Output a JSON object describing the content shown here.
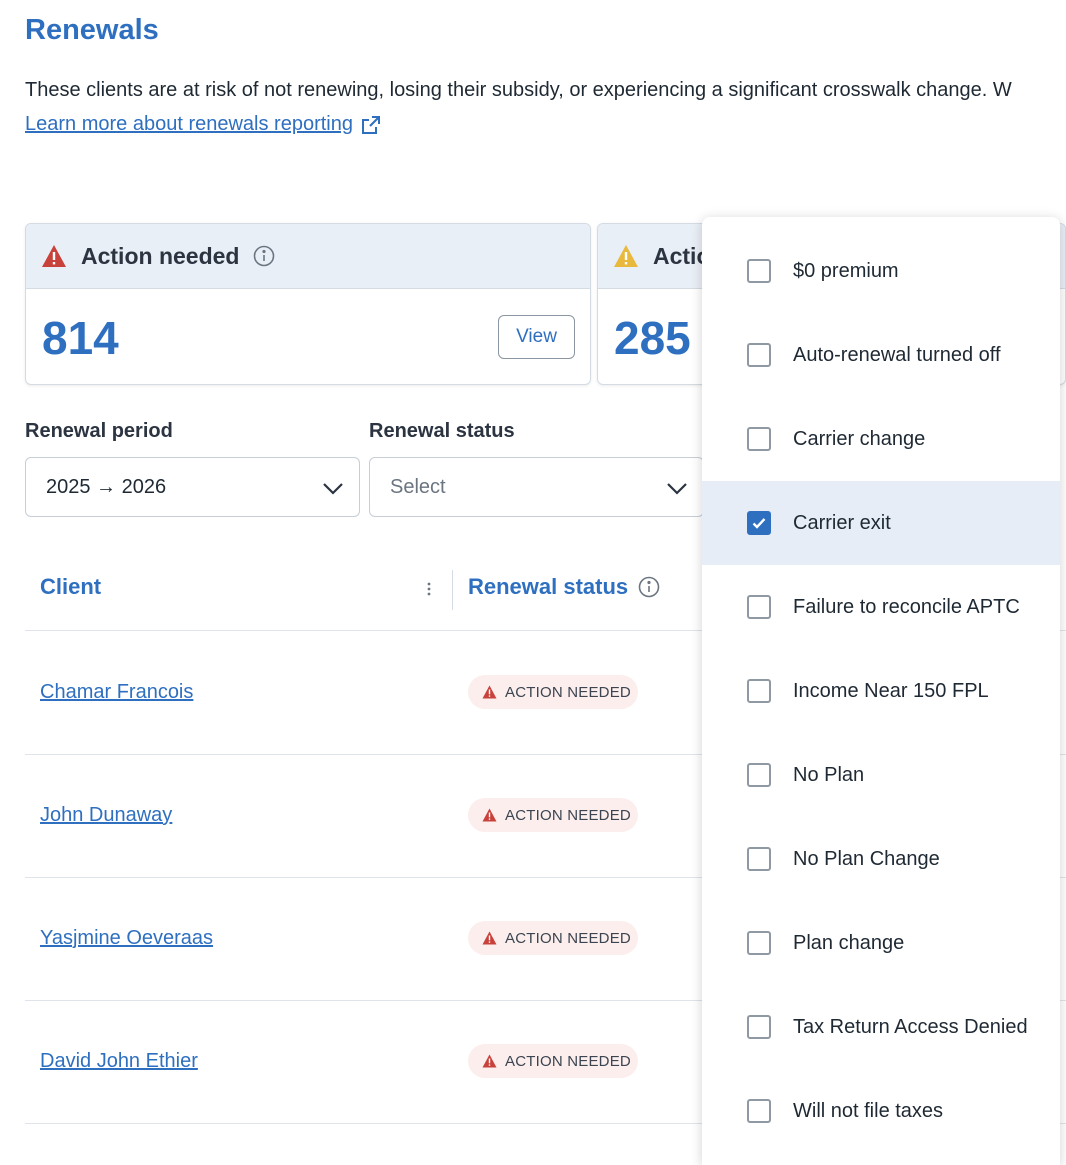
{
  "page": {
    "title": "Renewals",
    "intro": "These clients are at risk of not renewing, losing their subsidy, or experiencing a significant crosswalk change. W",
    "learn_more": "Learn more about renewals reporting"
  },
  "cards": [
    {
      "title": "Action needed",
      "count": "814",
      "view_label": "View",
      "icon": "warning-red-icon",
      "color": "#c8413b"
    },
    {
      "title": "Actio",
      "count": "285",
      "icon": "warning-yellow-icon",
      "color": "#e8b93c"
    }
  ],
  "filters": {
    "renewal_period": {
      "label": "Renewal period",
      "value": "2025 → 2026"
    },
    "renewal_status": {
      "label": "Renewal status",
      "placeholder": "Select"
    }
  },
  "table": {
    "headers": {
      "client": "Client",
      "renewal_status": "Renewal status"
    },
    "rows": [
      {
        "client": "Chamar Francois",
        "status": "ACTION NEEDED"
      },
      {
        "client": "John Dunaway",
        "status": "ACTION NEEDED"
      },
      {
        "client": "Yasjmine Oeveraas",
        "status": "ACTION NEEDED"
      },
      {
        "client": "David John Ethier",
        "status": "ACTION NEEDED"
      }
    ]
  },
  "dropdown": {
    "options": [
      {
        "label": "$0 premium",
        "checked": false
      },
      {
        "label": "Auto-renewal turned off",
        "checked": false
      },
      {
        "label": "Carrier change",
        "checked": false
      },
      {
        "label": "Carrier exit",
        "checked": true
      },
      {
        "label": "Failure to reconcile APTC",
        "checked": false
      },
      {
        "label": "Income Near 150 FPL",
        "checked": false
      },
      {
        "label": "No Plan",
        "checked": false
      },
      {
        "label": "No Plan Change",
        "checked": false
      },
      {
        "label": "Plan change",
        "checked": false
      },
      {
        "label": "Tax Return Access Denied",
        "checked": false
      },
      {
        "label": "Will not file taxes",
        "checked": false
      }
    ]
  },
  "colors": {
    "accent": "#2e6fc0",
    "danger": "#c8413b",
    "warning": "#e8b93c"
  }
}
